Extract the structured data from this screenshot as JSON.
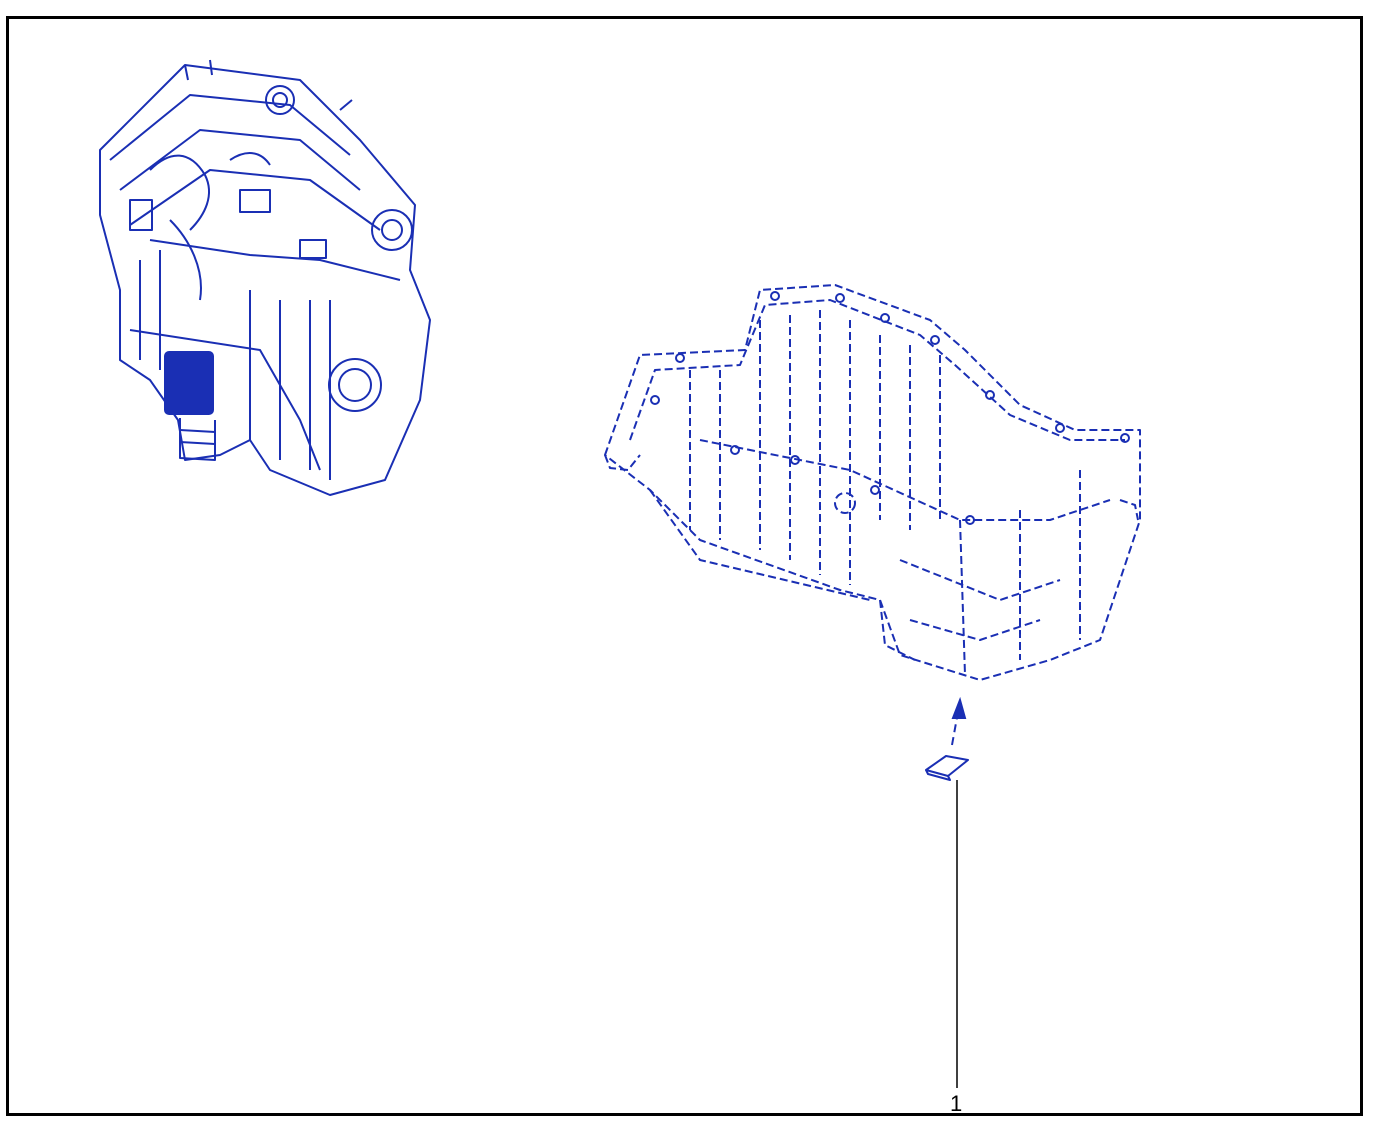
{
  "diagram": {
    "line_color": "#1a2fb4",
    "callouts": [
      {
        "label": "1",
        "part": "oil-pan-plug-insert"
      }
    ]
  }
}
